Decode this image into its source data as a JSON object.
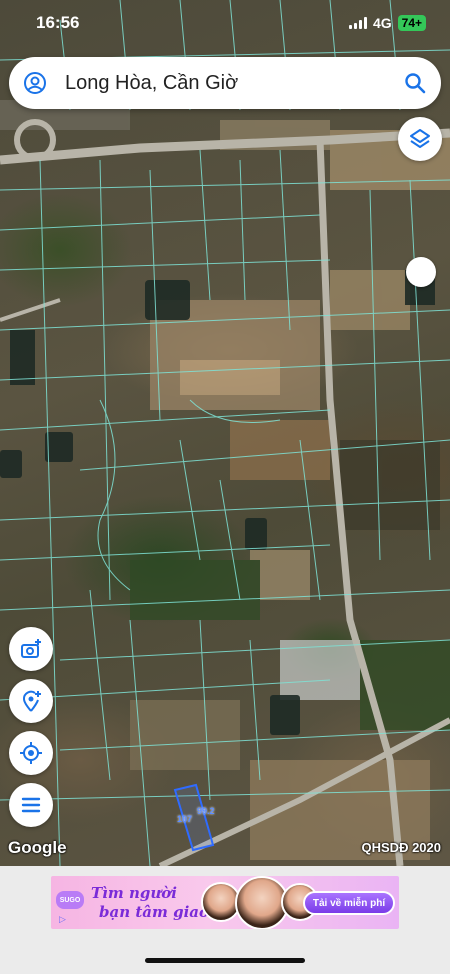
{
  "status_bar": {
    "time": "16:56",
    "network": "4G",
    "battery": "74+"
  },
  "search": {
    "text": "Long Hòa, Cần Giờ",
    "account_icon": "account-circle-icon",
    "search_icon": "search-icon"
  },
  "map": {
    "attribution": "Google",
    "layer_label": "QHSDĐ 2020",
    "parcel_labels": [
      "107",
      "99.2"
    ]
  },
  "side_buttons": [
    "layers-icon",
    "add-photo-icon",
    "add-place-icon",
    "my-location-icon",
    "menu-icon"
  ],
  "ad": {
    "brand": "SUGO",
    "headline_1": "Tìm người",
    "headline_2": "bạn tâm giao",
    "cta": "Tải về miễn phí"
  },
  "colors": {
    "parcel_lines": "#7fe3d6",
    "accent": "#1a73e8",
    "ad_purple": "#7a2bd8"
  }
}
